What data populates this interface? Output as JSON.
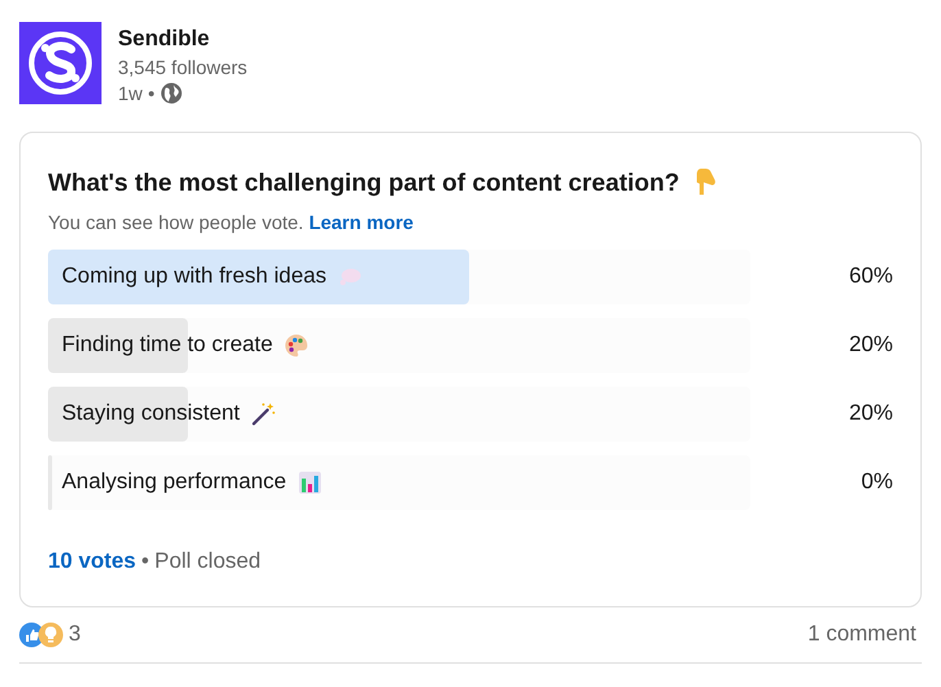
{
  "author": {
    "name": "Sendible",
    "followers": "3,545 followers",
    "time": "1w",
    "separator": "•"
  },
  "poll": {
    "question": "What's the most challenging part of content creation?",
    "note": "You can see how people vote.",
    "note_link": "Learn more",
    "options": [
      {
        "label": "Coming up with fresh ideas",
        "percent": "60%",
        "level": 0.6,
        "selected": true
      },
      {
        "label": "Finding time to create",
        "percent": "20%",
        "level": 0.2,
        "selected": false
      },
      {
        "label": "Staying consistent",
        "percent": "20%",
        "level": 0.2,
        "selected": false
      },
      {
        "label": "Analysing performance",
        "percent": "0%",
        "level": 0,
        "selected": false
      }
    ],
    "votes": "10 votes",
    "separator": "•",
    "status": "Poll closed"
  },
  "footer": {
    "reactions": "3",
    "comments": "1 comment"
  }
}
